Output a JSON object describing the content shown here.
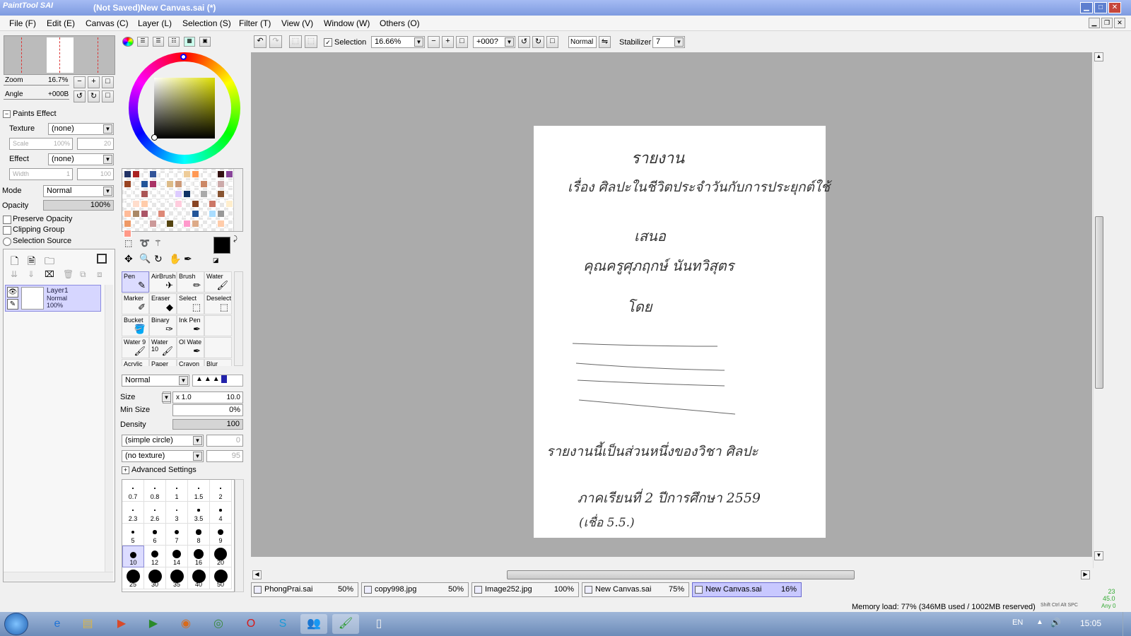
{
  "window": {
    "app_logo": "PaintTool SAI",
    "title": "(Not Saved)New Canvas.sai (*)"
  },
  "menu": [
    "File (F)",
    "Edit (E)",
    "Canvas (C)",
    "Layer (L)",
    "Selection (S)",
    "Filter (T)",
    "View (V)",
    "Window (W)",
    "Others (O)"
  ],
  "navigator": {
    "zoom_label": "Zoom",
    "zoom_value": "16.7%",
    "angle_label": "Angle",
    "angle_value": "+000B"
  },
  "paints_effect": {
    "header": "Paints Effect",
    "texture_label": "Texture",
    "texture_value": "(none)",
    "scale_label": "Scale",
    "scale_value": "100%",
    "scale_num": "20",
    "effect_label": "Effect",
    "effect_value": "(none)",
    "width_label": "Width",
    "width_value": "1",
    "width_num": "100"
  },
  "layer_props": {
    "mode_label": "Mode",
    "mode_value": "Normal",
    "opacity_label": "Opacity",
    "opacity_value": "100%",
    "preserve_opacity": "Preserve Opacity",
    "clipping_group": "Clipping Group",
    "selection_source": "Selection Source"
  },
  "layer": {
    "name": "Layer1",
    "mode": "Normal",
    "opacity": "100%"
  },
  "swatches": [
    "#223366",
    "#aa2222",
    "#ffffff",
    "#335599",
    "#ffffff",
    "#ffffff",
    "#ffffff",
    "#eecc99",
    "#ff9955",
    "#ffffff",
    "#ffffff",
    "#331111",
    "#884499",
    "#994422",
    "#ffffff",
    "#225599",
    "#aa3366",
    "#ffffff",
    "#ddbb88",
    "#cc9977",
    "#ffffff",
    "#ffffff",
    "#cc8866",
    "#ffffff",
    "#ccaaaa",
    "#ffffff",
    "#ffffff",
    "#ffffff",
    "#aa5555",
    "#ffffff",
    "#ffffff",
    "#ffffff",
    "#ddccff",
    "#113366",
    "#ffffff",
    "#aaaaaa",
    "#ffffff",
    "#885533",
    "#ffffff",
    "#ffffff",
    "#ffddcc",
    "#ffccaa",
    "#ffffff",
    "#ffffff",
    "#ffffff",
    "#ffccdd",
    "#ffffff",
    "#884422",
    "#ffffff",
    "#cc7766",
    "#ffffff",
    "#ffeecc",
    "#ffbb99",
    "#aa8866",
    "#aa5566",
    "#ffffff",
    "#dd8877",
    "#ffffff",
    "#ffffff",
    "#ffffff",
    "#225599",
    "#ffffff",
    "#aaddff",
    "#999999",
    "#ffffff",
    "#ee9966",
    "#ffffff",
    "#ffffff",
    "#cc9999",
    "#ffffff",
    "#554411",
    "#ffffff",
    "#ff99cc",
    "#ddaa88",
    "#ffffff",
    "#ffffff",
    "#ffccaa",
    "#ffffff",
    "#ff9988"
  ],
  "tools": [
    {
      "label": "Pen",
      "sel": true
    },
    {
      "label": "AirBrush"
    },
    {
      "label": "Brush"
    },
    {
      "label": "Water"
    },
    {
      "label": "Marker"
    },
    {
      "label": "Eraser"
    },
    {
      "label": "Select"
    },
    {
      "label": "Deselect"
    },
    {
      "label": "Bucket"
    },
    {
      "label": "Binary"
    },
    {
      "label": "Ink Pen"
    },
    {
      "label": ""
    },
    {
      "label": "Water 9"
    },
    {
      "label": "Water 10"
    },
    {
      "label": "Ol Wate"
    },
    {
      "label": ""
    },
    {
      "label": "Acrylic"
    },
    {
      "label": "Paper"
    },
    {
      "label": "Crayon"
    },
    {
      "label": "Blur"
    }
  ],
  "brush": {
    "mode": "Normal",
    "size_label": "Size",
    "size_mult": "x 1.0",
    "size_value": "10.0",
    "min_size_label": "Min Size",
    "min_size_value": "0%",
    "density_label": "Density",
    "density_value": "100",
    "shape": "(simple circle)",
    "shape_num": "0",
    "texture": "(no texture)",
    "texture_num": "95",
    "advanced": "Advanced Settings"
  },
  "brush_sizes": [
    "0.7",
    "0.8",
    "1",
    "1.5",
    "2",
    "2.3",
    "2.6",
    "3",
    "3.5",
    "4",
    "5",
    "6",
    "7",
    "8",
    "9",
    "10",
    "12",
    "14",
    "16",
    "20",
    "25",
    "30",
    "35",
    "40",
    "50"
  ],
  "toolbar": {
    "selection_label": "Selection",
    "zoom": "16.66%",
    "angle": "+000?",
    "blend": "Normal",
    "stabilizer_label": "Stabilizer",
    "stabilizer_value": "7"
  },
  "tabs": [
    {
      "name": "PhongPrai.sai",
      "pct": "50%"
    },
    {
      "name": "copy998.jpg",
      "pct": "50%"
    },
    {
      "name": "Image252.jpg",
      "pct": "100%"
    },
    {
      "name": "New Canvas.sai",
      "pct": "75%"
    },
    {
      "name": "New Canvas.sai",
      "pct": "16%",
      "active": true
    }
  ],
  "status": {
    "memory": "Memory load: 77% (346MB used / 1002MB reserved)",
    "keys": "Shift Ctrl Alt SPC",
    "angle": "Any",
    "num1": "23",
    "num2": "45.0",
    "num3": "0"
  },
  "taskbar": {
    "lang": "EN",
    "time": "15:05"
  },
  "canvas_text": [
    "รายงาน",
    "เรื่อง ศิลปะในชีวิตประจำวันกับการประยุกต์ใช้",
    "เสนอ",
    "คุณครูศุภฤกษ์ นันทวิสุตร",
    "โดย",
    "รายงานนี้เป็นส่วนหนึ่งของวิชา ศิลปะ",
    "ภาคเรียนที่ 2 ปีการศึกษา 2559",
    "(เชื่อ 5.5.)"
  ]
}
